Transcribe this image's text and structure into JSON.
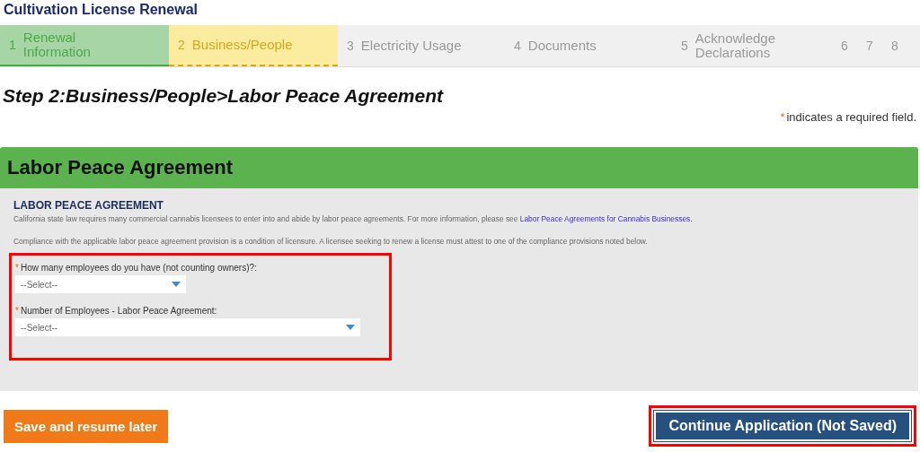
{
  "page_title": "Cultivation License Renewal",
  "steps": [
    {
      "number": "1",
      "label": "Renewal Information",
      "completed": true,
      "selected": false
    },
    {
      "number": "2",
      "label": "Business/People",
      "completed": false,
      "selected": true
    },
    {
      "number": "3",
      "label": "Electricity Usage",
      "completed": false,
      "selected": false
    },
    {
      "number": "4",
      "label": "Documents",
      "completed": false,
      "selected": false
    },
    {
      "number": "5",
      "label": "Acknowledge Declarations",
      "completed": false,
      "selected": false
    },
    {
      "number": "6",
      "completed": false,
      "selected": false
    },
    {
      "number": "7",
      "completed": false,
      "selected": false
    },
    {
      "number": "8",
      "completed": false,
      "selected": false
    }
  ],
  "step_heading": "Step 2:Business/People>Labor Peace Agreement",
  "required_note": {
    "mark": "*",
    "text": "indicates a required field."
  },
  "section": {
    "title": "Labor Peace Agreement",
    "subtitle": "LABOR PEACE AGREEMENT",
    "intro": "California state law requires many commercial cannabis licensees to enter into and abide by labor peace agreements. For more information, please see ",
    "link": "Labor Peace Agreements for Cannabis Businesses.",
    "note": "Compliance with the applicable labor peace agreement provision is a condition of licensure. A licensee seeking to renew a license must attest to one of the compliance provisions noted below.",
    "highlighted": true,
    "fields": [
      {
        "required": true,
        "label": "How many employees do you have (not counting owners)?:",
        "value": "--Select--",
        "wide": false
      },
      {
        "required": true,
        "label": "Number of Employees - Labor Peace Agreement:",
        "value": "--Select--",
        "wide": true
      }
    ]
  },
  "buttons": {
    "save": "Save and resume later",
    "continue": "Continue Application (Not Saved)",
    "continue_highlighted": true
  }
}
